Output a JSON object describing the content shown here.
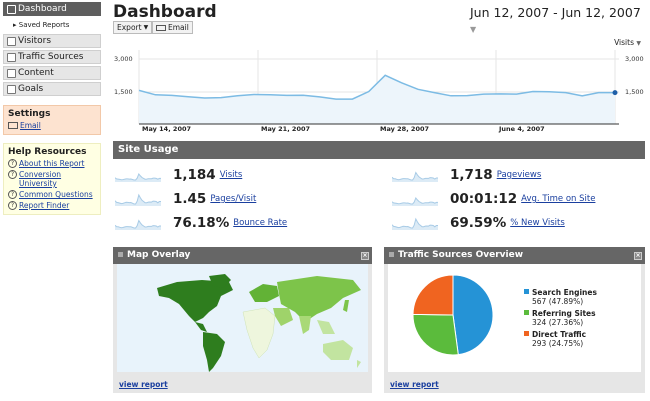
{
  "sidebar": {
    "items": [
      {
        "label": "Dashboard",
        "icon": "dashboard-icon",
        "active": true
      },
      {
        "label": "Saved Reports",
        "sub": true
      },
      {
        "label": "Visitors",
        "icon": "visitors-icon"
      },
      {
        "label": "Traffic Sources",
        "icon": "traffic-sources-icon"
      },
      {
        "label": "Content",
        "icon": "content-icon"
      },
      {
        "label": "Goals",
        "icon": "goals-icon"
      }
    ],
    "settings": {
      "title": "Settings",
      "email": "Email"
    },
    "help": {
      "title": "Help Resources",
      "links": [
        "About this Report",
        "Conversion University",
        "Common Questions",
        "Report Finder"
      ]
    }
  },
  "header": {
    "title": "Dashboard",
    "date_range": "Jun 12, 2007 - Jun 12, 2007",
    "export_label": "Export",
    "email_label": "Email"
  },
  "graph": {
    "metric": "Visits",
    "y_top": "3,000",
    "y_mid": "1,500",
    "dates": [
      "May 14, 2007",
      "May 21, 2007",
      "May 28, 2007",
      "June 4, 2007"
    ]
  },
  "chart_data": {
    "type": "line",
    "series": [
      {
        "name": "Visits",
        "values": [
          1550,
          1350,
          1320,
          1260,
          1200,
          1220,
          1300,
          1360,
          1350,
          1320,
          1330,
          1250,
          1150,
          1150,
          1500,
          2250,
          1900,
          1600,
          1450,
          1300,
          1310,
          1380,
          1390,
          1380,
          1500,
          1490,
          1450,
          1300,
          1450,
          1450
        ]
      }
    ],
    "ylim": [
      0,
      3000
    ],
    "ticks": [
      1500,
      3000
    ],
    "colors": {
      "line": "#7cbbe4",
      "fill": "#edf5fb"
    }
  },
  "site_usage": {
    "title": "Site Usage",
    "stats": [
      {
        "value": "1,184",
        "label": "Visits"
      },
      {
        "value": "1,718",
        "label": "Pageviews"
      },
      {
        "value": "1.45",
        "label": "Pages/Visit"
      },
      {
        "value": "00:01:12",
        "label": "Avg. Time on Site"
      },
      {
        "value": "76.18%",
        "label": "Bounce Rate"
      },
      {
        "value": "69.59%",
        "label": "% New Visits"
      }
    ]
  },
  "map_overlay": {
    "title": "Map Overlay",
    "view_report": "view report"
  },
  "traffic_sources": {
    "title": "Traffic Sources Overview",
    "view_report": "view report",
    "sources": [
      {
        "name": "Search Engines",
        "detail": "567 (47.89%)",
        "share": 47.89,
        "color": "#2593d6"
      },
      {
        "name": "Referring Sites",
        "detail": "324 (27.36%)",
        "share": 27.36,
        "color": "#5bbb3c"
      },
      {
        "name": "Direct Traffic",
        "detail": "293 (24.75%)",
        "share": 24.75,
        "color": "#f06420"
      }
    ]
  }
}
